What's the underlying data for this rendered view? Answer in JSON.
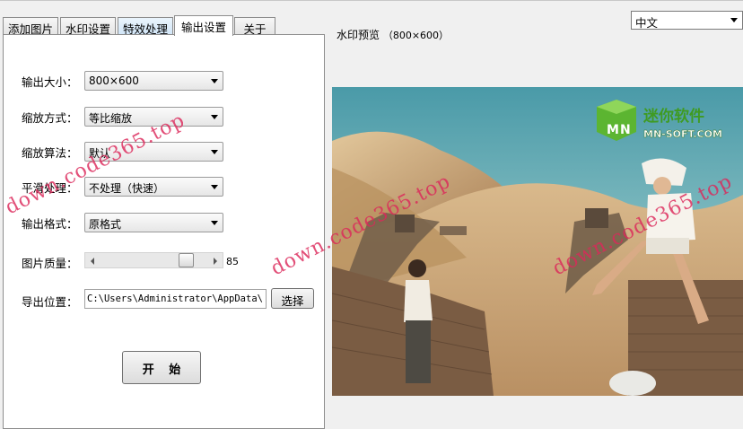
{
  "tabs": [
    "添加图片",
    "水印设置",
    "特效处理",
    "输出设置",
    "关于"
  ],
  "form": {
    "output_size": {
      "label": "输出大小：",
      "value": "800×600"
    },
    "scale_mode": {
      "label": "缩放方式：",
      "value": "等比缩放"
    },
    "scale_algo": {
      "label": "缩放算法：",
      "value": "默认"
    },
    "smoothing": {
      "label": "平滑处理：",
      "value": "不处理（快速）"
    },
    "format": {
      "label": "输出格式：",
      "value": "原格式"
    },
    "quality": {
      "label": "图片质量：",
      "value": 85,
      "display": "85"
    },
    "export": {
      "label": "导出位置：",
      "path": "C:\\Users\\Administrator\\AppData\\",
      "choose": "选择"
    },
    "start": "开 始"
  },
  "preview": {
    "title": "水印预览",
    "size": "（800×600）",
    "logo_cn": "迷你软件",
    "logo_en": "MN-SOFT.COM",
    "logo_m": "M",
    "logo_n": "N"
  },
  "language": {
    "value": "中文"
  },
  "watermark": "down.code365.top",
  "colors": {
    "accent": "#5cb531",
    "watermark": "#dc285a"
  }
}
